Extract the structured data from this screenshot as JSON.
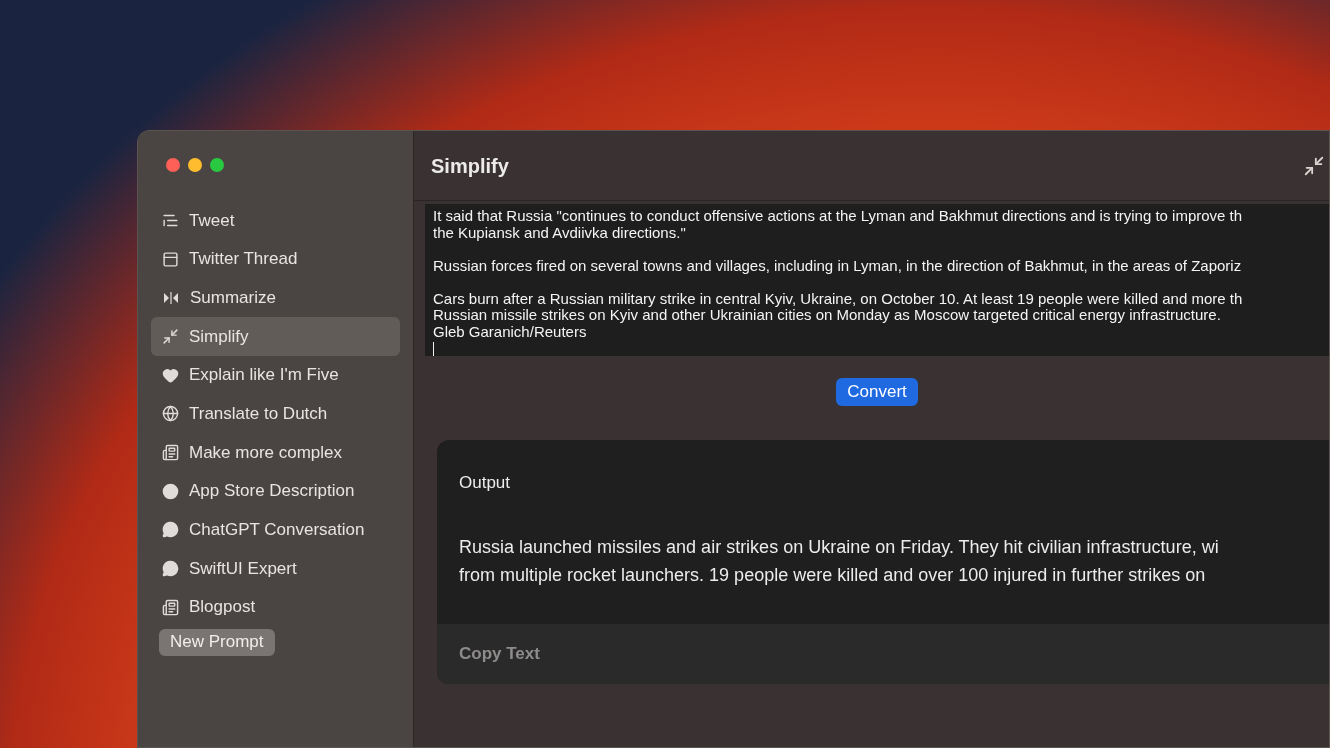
{
  "window": {
    "title": "Simplify"
  },
  "sidebar": {
    "items": [
      {
        "label": "Tweet",
        "selected": false
      },
      {
        "label": "Twitter Thread",
        "selected": false
      },
      {
        "label": "Summarize",
        "selected": false
      },
      {
        "label": "Simplify",
        "selected": true
      },
      {
        "label": "Explain like I'm Five",
        "selected": false
      },
      {
        "label": "Translate to Dutch",
        "selected": false
      },
      {
        "label": "Make more complex",
        "selected": false
      },
      {
        "label": "App Store Description",
        "selected": false
      },
      {
        "label": "ChatGPT Conversation",
        "selected": false
      },
      {
        "label": "SwiftUI Expert",
        "selected": false
      },
      {
        "label": "Blogpost",
        "selected": false
      }
    ],
    "new_prompt_button": "New Prompt"
  },
  "input": {
    "paragraphs": [
      [
        "It said that Russia \"continues to conduct offensive actions at the Lyman and Bakhmut directions and is trying to improve th",
        "the Kupiansk and Avdiivka directions.\""
      ],
      [
        "Russian forces fired on several towns and villages, including in Lyman, in the direction of Bakhmut, in the areas of Zaporiz"
      ],
      [
        "Cars burn after a Russian military strike in central Kyiv, Ukraine, on October 10. At least 19 people were killed and more th",
        "Russian missile strikes on Kyiv and other Ukrainian cities on Monday as Moscow targeted critical energy infrastructure.",
        "Gleb Garanich/Reuters"
      ]
    ]
  },
  "convert_button": "Convert",
  "output": {
    "title": "Output",
    "lines": [
      "Russia launched missiles and air strikes on Ukraine on Friday. They hit civilian infrastructure, wi",
      "from multiple rocket launchers. 19 people were killed and over 100 injured in further strikes on"
    ],
    "copy_button": "Copy Text"
  }
}
